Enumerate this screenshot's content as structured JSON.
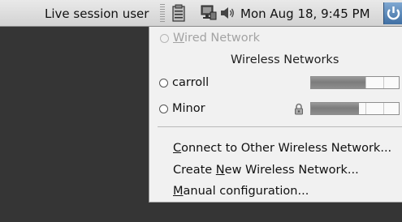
{
  "panel": {
    "user_label": "Live session user",
    "clock": "Mon Aug 18,  9:45 PM",
    "icons": [
      "separator-handle",
      "clipboard-icon",
      "network-monitor-icon",
      "volume-icon",
      "power-icon"
    ]
  },
  "menu": {
    "wired": {
      "prefix": "",
      "accel": "W",
      "rest": "ired Network"
    },
    "wireless_header": "Wireless Networks",
    "networks": [
      {
        "name": "carroll",
        "signal": 0.62,
        "locked": false
      },
      {
        "name": "Minor",
        "signal": 0.55,
        "locked": true
      }
    ],
    "actions": [
      {
        "prefix": "",
        "accel": "C",
        "rest": "onnect to Other Wireless Network..."
      },
      {
        "prefix": "Create ",
        "accel": "N",
        "rest": "ew Wireless Network..."
      },
      {
        "prefix": "",
        "accel": "M",
        "rest": "anual configuration..."
      }
    ]
  },
  "colors": {
    "desktop": "#353535",
    "panel": "#dcdcdc",
    "menu": "#f1f1f1",
    "power_button": "#4f7fb4"
  }
}
